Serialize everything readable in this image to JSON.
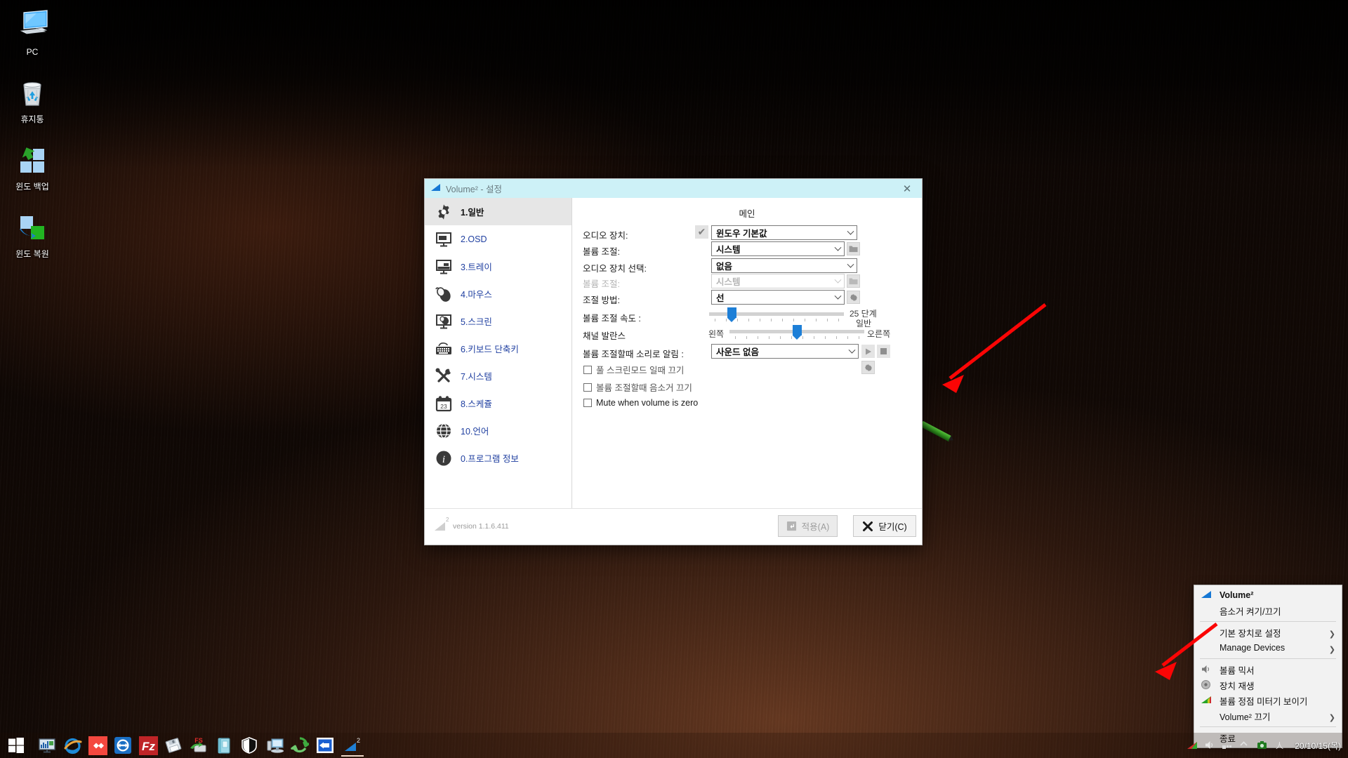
{
  "desktop": {
    "icons": [
      {
        "label": "PC",
        "icon": "computer-icon"
      },
      {
        "label": "휴지통",
        "icon": "recycle-bin-icon"
      },
      {
        "label": "윈도 백업",
        "icon": "windows-backup-icon"
      },
      {
        "label": "윈도 복원",
        "icon": "windows-restore-icon"
      }
    ]
  },
  "window": {
    "title": "Volume² - 설정",
    "close_label": "✕",
    "sidebar": [
      {
        "label": "1.일반",
        "icon": "gear-icon",
        "active": true
      },
      {
        "label": "2.OSD",
        "icon": "monitor-osd-icon",
        "active": false
      },
      {
        "label": "3.트레이",
        "icon": "tray-monitor-icon",
        "active": false
      },
      {
        "label": "4.마우스",
        "icon": "mouse-icon",
        "active": false
      },
      {
        "label": "5.스크린",
        "icon": "screen-mouse-icon",
        "active": false
      },
      {
        "label": "6.키보드 단축키",
        "icon": "keyboard-icon",
        "active": false
      },
      {
        "label": "7.시스템",
        "icon": "tools-icon",
        "active": false
      },
      {
        "label": "8.스케쥴",
        "icon": "calendar-icon",
        "day": "23",
        "active": false
      },
      {
        "label": "10.언어",
        "icon": "globe-icon",
        "active": false
      },
      {
        "label": "0.프로그램 정보",
        "icon": "info-icon",
        "active": false
      }
    ],
    "main": {
      "heading": "메인",
      "rows": {
        "audio_device_label": "오디오 장치:",
        "audio_device_value": "윈도우 기본값",
        "volume_control_label": "볼륨 조절:",
        "volume_control_value": "시스템",
        "audio_device_select_label": "오디오 장치 선택:",
        "audio_device_select_value": "없음",
        "volume_control2_label": "볼륨 조절:",
        "volume_control2_value": "시스템",
        "adjust_method_label": "조절 방법:",
        "adjust_method_value": "선",
        "volume_speed_label": "볼륨 조절 속도 :",
        "volume_speed_steps": "25 단계",
        "volume_speed_mode": "일반",
        "channel_balance_label": "채널 발란스",
        "balance_left": "왼쪽",
        "balance_right": "오른쪽",
        "sound_notify_label": "볼륨 조절할때 소리로 알림 :",
        "sound_notify_value": "사운드 없음"
      },
      "checkboxes": [
        {
          "label": "풀 스크린모드 일때 끄기",
          "checked": false
        },
        {
          "label": "볼륨 조절할때 음소거 끄기",
          "checked": false
        },
        {
          "label": "Mute when volume is zero",
          "checked": false
        }
      ],
      "sliders": {
        "speed_percent": 17,
        "balance_percent": 50
      }
    },
    "footer": {
      "version": "version 1.1.6.411",
      "apply_label": "적용(A)",
      "close_label": "닫기(C)"
    }
  },
  "tray_menu": {
    "items": [
      {
        "label": "Volume²",
        "icon": "volume2-logo-icon",
        "header": true,
        "submenu": false
      },
      {
        "label": "음소거 켜기/끄기",
        "icon": "",
        "header": false,
        "submenu": false
      },
      {
        "sep": true
      },
      {
        "label": "기본 장치로 설정",
        "icon": "",
        "header": false,
        "submenu": true
      },
      {
        "label": "Manage Devices",
        "icon": "",
        "header": false,
        "submenu": true
      },
      {
        "sep": true
      },
      {
        "label": "볼륨 믹서",
        "icon": "speaker-icon",
        "header": false,
        "submenu": false
      },
      {
        "label": "장치 재생",
        "icon": "playback-device-icon",
        "header": false,
        "submenu": false
      },
      {
        "label": "볼륨 정점 미터기 보이기",
        "icon": "peak-meter-icon",
        "header": false,
        "submenu": false
      },
      {
        "label": "Volume² 끄기",
        "icon": "",
        "header": false,
        "submenu": true
      },
      {
        "sep": true
      },
      {
        "label": "종료",
        "icon": "",
        "header": false,
        "submenu": false
      }
    ]
  },
  "taskbar": {
    "start_label": "start-icon",
    "pinned": [
      "network-monitor-icon",
      "internet-explorer-icon",
      "everything-icon",
      "teamviewer-icon",
      "filezilla-icon",
      "floppy-save-icon",
      "fs-backup-icon",
      "ebook-icon",
      "shield-defender-icon",
      "remote-desktop-icon",
      "recycle-refresh-icon",
      "login-icon"
    ],
    "running_label": "volume2-taskbar-button",
    "tray": [
      "volume2-tray-icon",
      "volume-tray-icon",
      "network-tray-icon",
      "show-hidden-icon",
      "greenshot-icon",
      "ime-icon"
    ],
    "clock": "20/10/15(목)"
  },
  "colors": {
    "titlebar": "#cdf1f7",
    "accent_blue": "#1d7fd7",
    "nav_link": "#1f3fa0",
    "annotation_red": "#fb0505"
  }
}
